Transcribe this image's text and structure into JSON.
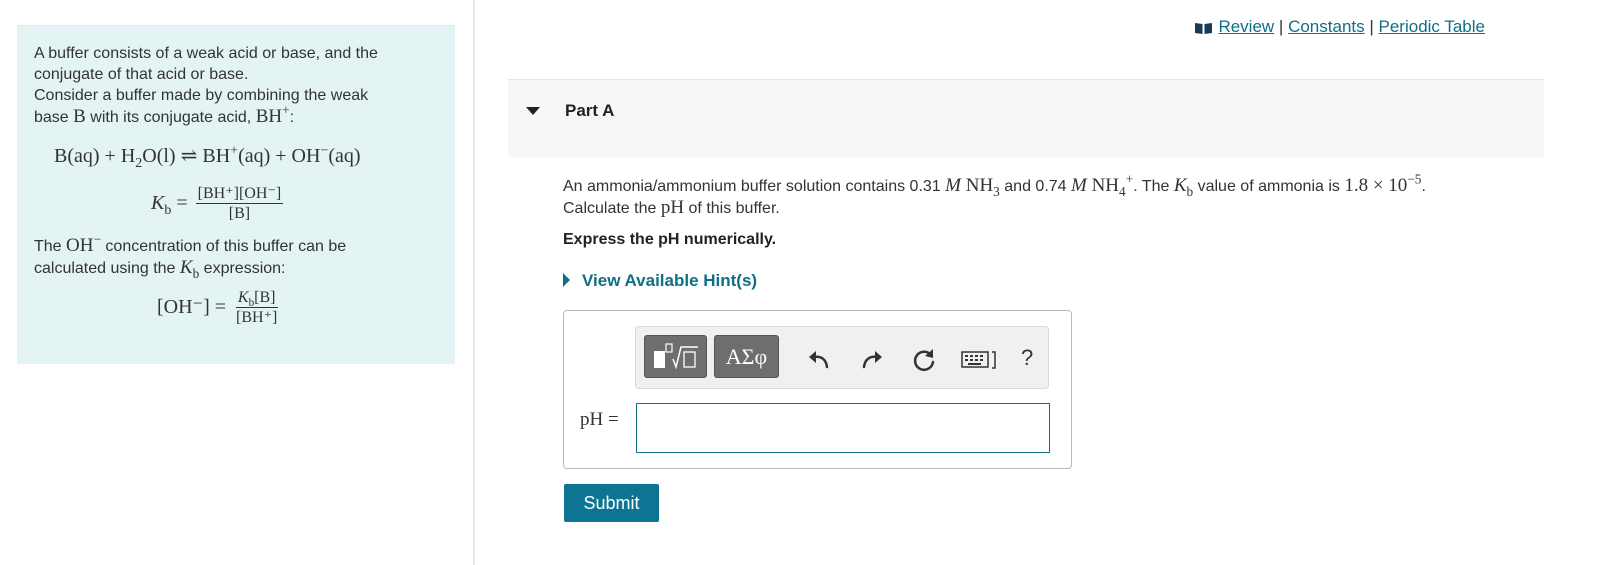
{
  "info": {
    "intro_line1": "A buffer consists of a weak acid or base, and the",
    "intro_line2": "conjugate of that acid or base.",
    "intro_line3": "Consider a buffer made by combining the weak",
    "intro_line4_pre": "base ",
    "intro_line4_b": "B",
    "intro_line4_mid": " with its conjugate acid, ",
    "intro_line4_bh": "BH",
    "intro_line4_end": ":",
    "reaction_left": "B(aq) + H",
    "reaction_h2o_end": "O(l)",
    "reaction_arrow": "⇌",
    "reaction_right": "BH",
    "reaction_right2": "(aq) + OH",
    "reaction_right3": "(aq)",
    "kb_lhs": "K",
    "kb_sub": "b",
    "kb_num": "[BH⁺][OH⁻]",
    "kb_den": "[B]",
    "oh_text_pre": "The ",
    "oh_text_oh": "OH",
    "oh_text_mid": " concentration of this buffer can be",
    "oh_text_line2_pre": "calculated using the ",
    "oh_text_line2_end": " expression:",
    "oh_lhs": "[OH⁻] =",
    "oh_num": "K",
    "oh_num_rest": "[B]",
    "oh_den": "[BH⁺]"
  },
  "links": {
    "review": "Review",
    "constants": "Constants",
    "periodic_table": "Periodic Table",
    "separator": "|"
  },
  "part": {
    "title": "Part A"
  },
  "question": {
    "p1": "An ammonia/ammonium buffer solution contains 0.31 ",
    "m": "M",
    "nh3": "NH",
    "p2": " and 0.74 ",
    "nh4": "NH",
    "p3": ". The ",
    "p4": " value of ammonia is ",
    "kb_value": "1.8 × 10",
    "kb_exp": "−5",
    "p5": ".",
    "line2_pre": "Calculate the ",
    "ph": "pH",
    "line2_end": " of this buffer."
  },
  "instruction": "Express the pH numerically.",
  "hints_label": "View Available Hint(s)",
  "toolbar": {
    "symbols_label": "ΑΣφ",
    "help_label": "?"
  },
  "answer": {
    "label": "pH =",
    "value": ""
  },
  "submit_label": "Submit"
}
